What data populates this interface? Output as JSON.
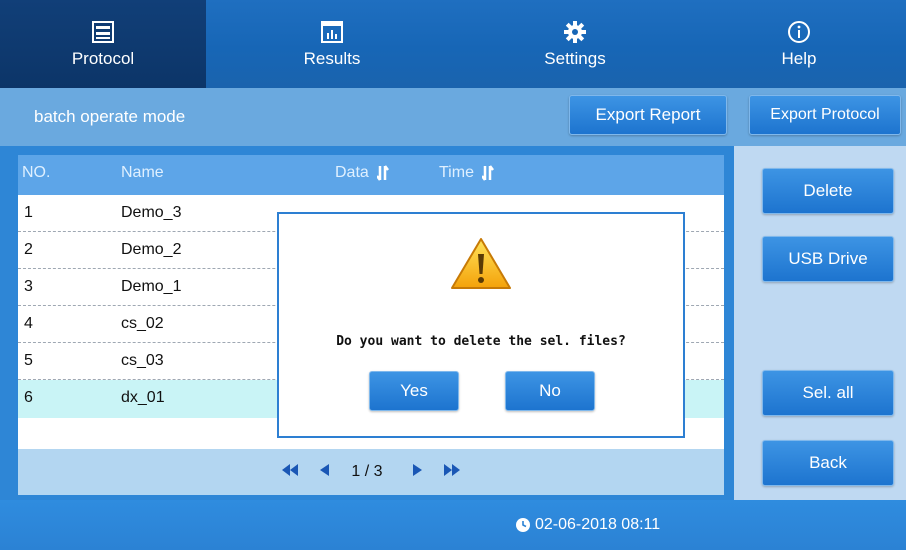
{
  "nav": {
    "tabs": [
      {
        "label": "Protocol",
        "icon": "monitor-icon",
        "active": true
      },
      {
        "label": "Results",
        "icon": "chart-icon",
        "active": false
      },
      {
        "label": "Settings",
        "icon": "gear-icon",
        "active": false
      },
      {
        "label": "Help",
        "icon": "info-icon",
        "active": false
      }
    ]
  },
  "toolbar": {
    "mode_label": "batch operate mode",
    "export_report": "Export Report",
    "export_protocol": "Export Protocol"
  },
  "table": {
    "columns": {
      "no": "NO.",
      "name": "Name",
      "data": "Data",
      "time": "Time"
    },
    "rows": [
      {
        "no": "1",
        "name": "Demo_3"
      },
      {
        "no": "2",
        "name": "Demo_2"
      },
      {
        "no": "3",
        "name": "Demo_1"
      },
      {
        "no": "4",
        "name": "cs_02"
      },
      {
        "no": "5",
        "name": "cs_03"
      },
      {
        "no": "6",
        "name": "dx_01",
        "selected": true
      }
    ]
  },
  "pager": {
    "page": "1 / 3"
  },
  "side": {
    "delete": "Delete",
    "usb": "USB Drive",
    "select_all": "Sel. all",
    "back": "Back"
  },
  "dialog": {
    "message": "Do you want to delete the sel. files?",
    "yes": "Yes",
    "no": "No",
    "icon": "warning-icon"
  },
  "status": {
    "datetime": "02-06-2018 08:11",
    "icon": "clock-icon"
  },
  "colors": {
    "accent": "#2d7fd2",
    "selected_row": "#c9f4f6",
    "nav_active": "#0c3568"
  }
}
